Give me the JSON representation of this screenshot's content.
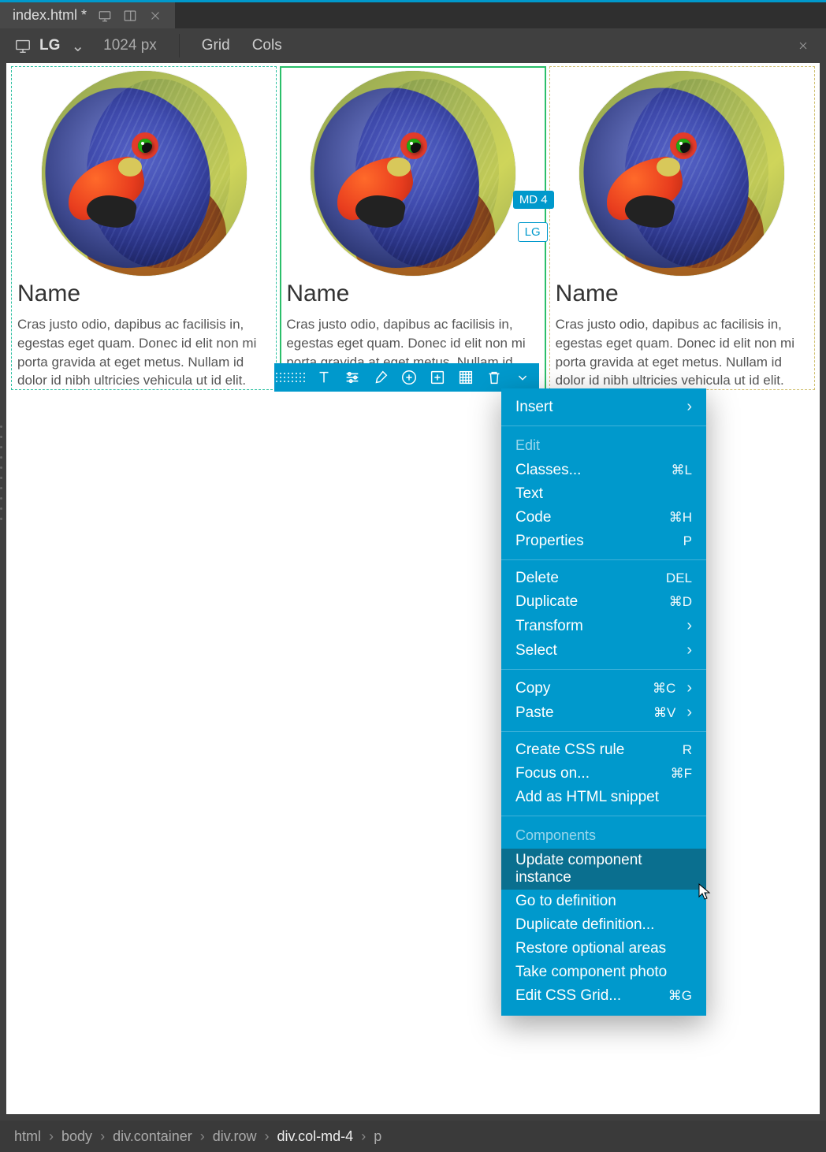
{
  "tab": {
    "title": "index.html *"
  },
  "toolbar": {
    "size_label": "LG",
    "px_label": "1024 px",
    "grid_label": "Grid",
    "cols_label": "Cols"
  },
  "cards": [
    {
      "title": "Name",
      "text": "Cras justo odio, dapibus ac facilisis in, egestas eget quam. Donec id elit non mi porta gravida at eget metus. Nullam id dolor id nibh ultricies vehicula ut id elit."
    },
    {
      "title": "Name",
      "text": "Cras justo odio, dapibus ac facilisis in, egestas eget quam. Donec id elit non mi porta gravida at eget metus. Nullam id dolor id nibh ultricies vehicula ut id elit."
    },
    {
      "title": "Name",
      "text": "Cras justo odio, dapibus ac facilisis in, egestas eget quam. Donec id elit non mi porta gravida at eget metus. Nullam id dolor id nibh ultricies vehicula ut id elit."
    }
  ],
  "badges": {
    "md": "MD 4",
    "lg": "LG"
  },
  "ctx": {
    "insert": "Insert",
    "edit_header": "Edit",
    "classes": "Classes...",
    "classes_sc": "⌘L",
    "text": "Text",
    "code": "Code",
    "code_sc": "⌘H",
    "properties": "Properties",
    "properties_sc": "P",
    "delete": "Delete",
    "delete_sc": "DEL",
    "duplicate": "Duplicate",
    "duplicate_sc": "⌘D",
    "transform": "Transform",
    "select": "Select",
    "copy": "Copy",
    "copy_sc": "⌘C",
    "paste": "Paste",
    "paste_sc": "⌘V",
    "create_rule": "Create CSS rule",
    "create_rule_sc": "R",
    "focus_on": "Focus on...",
    "focus_on_sc": "⌘F",
    "add_snippet": "Add as HTML snippet",
    "components_header": "Components",
    "update_instance": "Update component instance",
    "go_def": "Go to definition",
    "dup_def": "Duplicate definition...",
    "restore_opt": "Restore optional areas",
    "photo": "Take component photo",
    "edit_grid": "Edit CSS Grid...",
    "edit_grid_sc": "⌘G"
  },
  "breadcrumb": {
    "s0": "html",
    "s1": "body",
    "s2": "div.container",
    "s3": "div.row",
    "s4": "div.col-md-4",
    "s5": "p"
  }
}
